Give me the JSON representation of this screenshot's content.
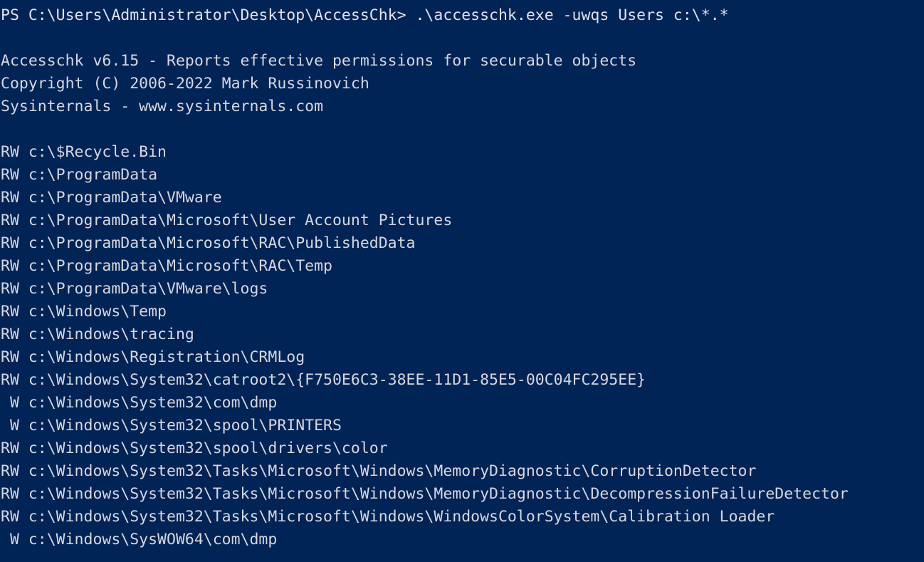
{
  "window": {
    "app": "Windows PowerShell",
    "background_color": "#012456",
    "foreground_color": "#d6d7de"
  },
  "terminal": {
    "prompt": "PS C:\\Users\\Administrator\\Desktop\\AccessChk>",
    "command": ".\\accesschk.exe -uwqs Users c:\\*.*",
    "prompt_line": "PS C:\\Users\\Administrator\\Desktop\\AccessChk> .\\accesschk.exe -uwqs Users c:\\*.*",
    "banner": [
      "Accesschk v6.15 - Reports effective permissions for securable objects",
      "Copyright (C) 2006-2022 Mark Russinovich",
      "Sysinternals - www.sysinternals.com"
    ],
    "results": [
      {
        "access": "RW",
        "path": "c:\\$Recycle.Bin",
        "line": "RW c:\\$Recycle.Bin"
      },
      {
        "access": "RW",
        "path": "c:\\ProgramData",
        "line": "RW c:\\ProgramData"
      },
      {
        "access": "RW",
        "path": "c:\\ProgramData\\VMware",
        "line": "RW c:\\ProgramData\\VMware"
      },
      {
        "access": "RW",
        "path": "c:\\ProgramData\\Microsoft\\User Account Pictures",
        "line": "RW c:\\ProgramData\\Microsoft\\User Account Pictures"
      },
      {
        "access": "RW",
        "path": "c:\\ProgramData\\Microsoft\\RAC\\PublishedData",
        "line": "RW c:\\ProgramData\\Microsoft\\RAC\\PublishedData"
      },
      {
        "access": "RW",
        "path": "c:\\ProgramData\\Microsoft\\RAC\\Temp",
        "line": "RW c:\\ProgramData\\Microsoft\\RAC\\Temp"
      },
      {
        "access": "RW",
        "path": "c:\\ProgramData\\VMware\\logs",
        "line": "RW c:\\ProgramData\\VMware\\logs"
      },
      {
        "access": "RW",
        "path": "c:\\Windows\\Temp",
        "line": "RW c:\\Windows\\Temp"
      },
      {
        "access": "RW",
        "path": "c:\\Windows\\tracing",
        "line": "RW c:\\Windows\\tracing"
      },
      {
        "access": "RW",
        "path": "c:\\Windows\\Registration\\CRMLog",
        "line": "RW c:\\Windows\\Registration\\CRMLog"
      },
      {
        "access": "RW",
        "path": "c:\\Windows\\System32\\catroot2\\{F750E6C3-38EE-11D1-85E5-00C04FC295EE}",
        "line": "RW c:\\Windows\\System32\\catroot2\\{F750E6C3-38EE-11D1-85E5-00C04FC295EE}"
      },
      {
        "access": "W",
        "path": "c:\\Windows\\System32\\com\\dmp",
        "line": " W c:\\Windows\\System32\\com\\dmp"
      },
      {
        "access": "W",
        "path": "c:\\Windows\\System32\\spool\\PRINTERS",
        "line": " W c:\\Windows\\System32\\spool\\PRINTERS"
      },
      {
        "access": "RW",
        "path": "c:\\Windows\\System32\\spool\\drivers\\color",
        "line": "RW c:\\Windows\\System32\\spool\\drivers\\color"
      },
      {
        "access": "RW",
        "path": "c:\\Windows\\System32\\Tasks\\Microsoft\\Windows\\MemoryDiagnostic\\CorruptionDetector",
        "line": "RW c:\\Windows\\System32\\Tasks\\Microsoft\\Windows\\MemoryDiagnostic\\CorruptionDetector"
      },
      {
        "access": "RW",
        "path": "c:\\Windows\\System32\\Tasks\\Microsoft\\Windows\\MemoryDiagnostic\\DecompressionFailureDetector",
        "line": "RW c:\\Windows\\System32\\Tasks\\Microsoft\\Windows\\MemoryDiagnostic\\DecompressionFailureDetector"
      },
      {
        "access": "RW",
        "path": "c:\\Windows\\System32\\Tasks\\Microsoft\\Windows\\WindowsColorSystem\\Calibration Loader",
        "line": "RW c:\\Windows\\System32\\Tasks\\Microsoft\\Windows\\WindowsColorSystem\\Calibration Loader"
      },
      {
        "access": "W",
        "path": "c:\\Windows\\SysWOW64\\com\\dmp",
        "line": " W c:\\Windows\\SysWOW64\\com\\dmp"
      }
    ],
    "lines": [
      "PS C:\\Users\\Administrator\\Desktop\\AccessChk> .\\accesschk.exe -uwqs Users c:\\*.*",
      "",
      "Accesschk v6.15 - Reports effective permissions for securable objects",
      "Copyright (C) 2006-2022 Mark Russinovich",
      "Sysinternals - www.sysinternals.com",
      "",
      "RW c:\\$Recycle.Bin",
      "RW c:\\ProgramData",
      "RW c:\\ProgramData\\VMware",
      "RW c:\\ProgramData\\Microsoft\\User Account Pictures",
      "RW c:\\ProgramData\\Microsoft\\RAC\\PublishedData",
      "RW c:\\ProgramData\\Microsoft\\RAC\\Temp",
      "RW c:\\ProgramData\\VMware\\logs",
      "RW c:\\Windows\\Temp",
      "RW c:\\Windows\\tracing",
      "RW c:\\Windows\\Registration\\CRMLog",
      "RW c:\\Windows\\System32\\catroot2\\{F750E6C3-38EE-11D1-85E5-00C04FC295EE}",
      " W c:\\Windows\\System32\\com\\dmp",
      " W c:\\Windows\\System32\\spool\\PRINTERS",
      "RW c:\\Windows\\System32\\spool\\drivers\\color",
      "RW c:\\Windows\\System32\\Tasks\\Microsoft\\Windows\\MemoryDiagnostic\\CorruptionDetector",
      "RW c:\\Windows\\System32\\Tasks\\Microsoft\\Windows\\MemoryDiagnostic\\DecompressionFailureDetector",
      "RW c:\\Windows\\System32\\Tasks\\Microsoft\\Windows\\WindowsColorSystem\\Calibration Loader",
      " W c:\\Windows\\SysWOW64\\com\\dmp"
    ]
  }
}
